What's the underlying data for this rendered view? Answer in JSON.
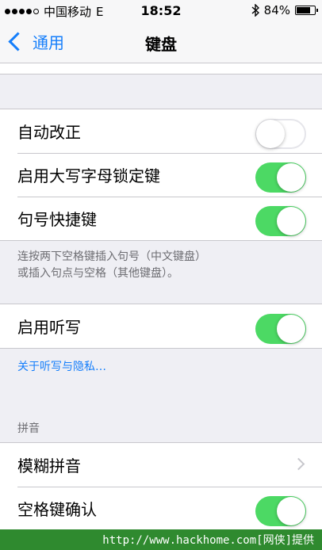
{
  "status_bar": {
    "carrier": "中国移动",
    "network": "E",
    "time": "18:52",
    "battery_percent": "84%",
    "battery_level": 0.84
  },
  "nav": {
    "back_label": "通用",
    "title": "键盘"
  },
  "group1": [
    {
      "label": "自动改正",
      "toggle": false
    },
    {
      "label": "启用大写字母锁定键",
      "toggle": true
    },
    {
      "label": "句号快捷键",
      "toggle": true
    }
  ],
  "group1_footer": [
    "连按两下空格键插入句号（中文键盘）",
    "或插入句点与空格（其他键盘）。"
  ],
  "group2": [
    {
      "label": "启用听写",
      "toggle": true
    }
  ],
  "dictation_link": "关于听写与隐私…",
  "pinyin_header": "拼音",
  "group3": [
    {
      "label": "模糊拼音"
    },
    {
      "label": "空格键确认",
      "toggle": true
    }
  ],
  "watermark": "http://www.hackhome.com[网侠]提供",
  "colors": {
    "accent": "#147efb",
    "switch_on": "#4cd964",
    "background": "#efeff4"
  }
}
